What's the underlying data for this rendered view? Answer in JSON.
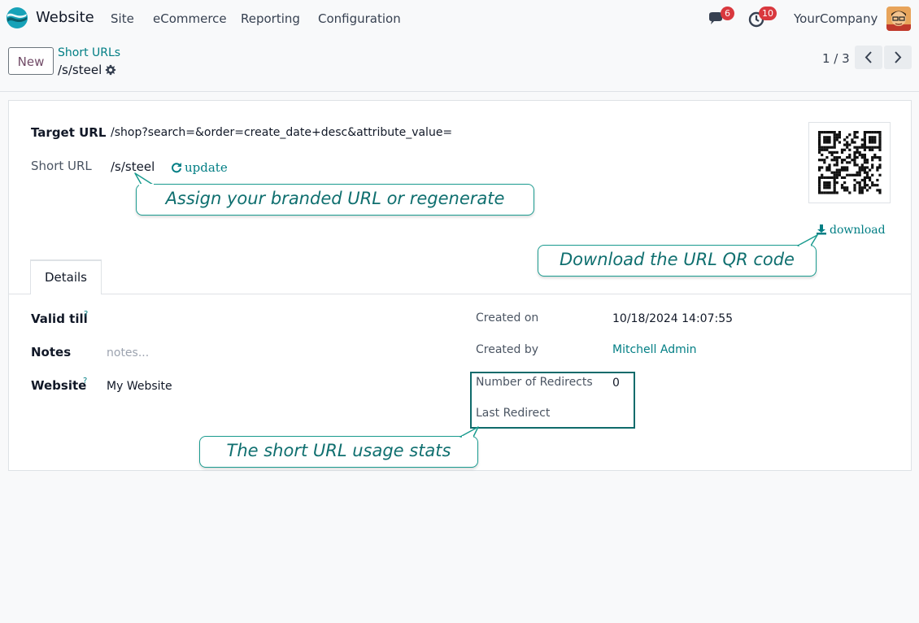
{
  "navbar": {
    "app_name": "Website",
    "menu": [
      "Site",
      "eCommerce",
      "Reporting",
      "Configuration"
    ],
    "messages_badge": "6",
    "activities_badge": "10",
    "company": "YourCompany",
    "icons": {
      "app": "website-logo-icon",
      "messages": "chat-icon",
      "activities": "clock-icon"
    }
  },
  "control_panel": {
    "new_label": "New",
    "breadcrumb_parent": "Short URLs",
    "breadcrumb_current": "/s/steel",
    "pager": "1 / 3"
  },
  "form": {
    "target_url_label": "Target URL",
    "target_url_value": "/shop?search=&order=create_date+desc&attribute_value=",
    "short_url_label": "Short URL",
    "short_url_value": "/s/steel",
    "update_label": "update",
    "download_label": "download",
    "tab_details": "Details",
    "valid_till_label": "Valid till",
    "help_mark": "?",
    "notes_label": "Notes",
    "notes_placeholder": "notes...",
    "website_label": "Website",
    "website_value": "My Website",
    "created_on_label": "Created on",
    "created_on_value": "10/18/2024 14:07:55",
    "created_by_label": "Created by",
    "created_by_value": "Mitchell Admin",
    "redirects_label": "Number of Redirects",
    "redirects_value": "0",
    "last_redirect_label": "Last Redirect"
  },
  "tooltips": {
    "branded": "Assign your branded URL or regenerate",
    "qr": "Download the URL QR code",
    "stats": "The short URL usage stats"
  },
  "colors": {
    "accent": "#017e84",
    "brand_button": "#714b67",
    "badge": "#d9383e",
    "tooltip": "#1a9b8f"
  }
}
